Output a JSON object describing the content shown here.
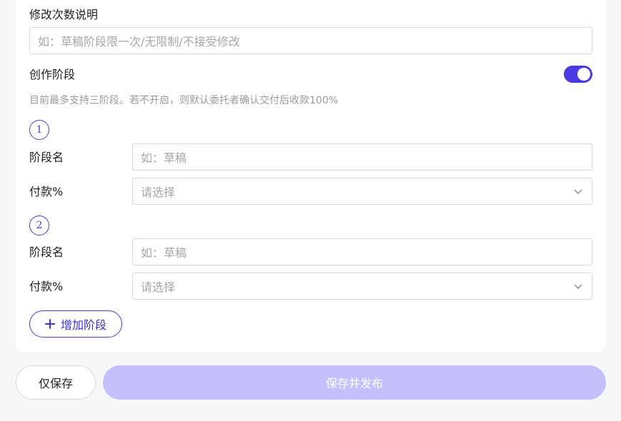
{
  "form": {
    "revision_label": "修改次数说明",
    "revision_placeholder": "如：草稿阶段限一次/无限制/不接受修改",
    "stages_label": "创作阶段",
    "stages_enabled": true,
    "stages_hint": "目前最多支持三阶段。若不开启，则默认委托者确认交付后收款100%",
    "stages": [
      {
        "number": "1",
        "name_label": "阶段名",
        "name_placeholder": "如：草稿",
        "payment_label": "付款%",
        "payment_placeholder": "请选择"
      },
      {
        "number": "2",
        "name_label": "阶段名",
        "name_placeholder": "如：草稿",
        "payment_label": "付款%",
        "payment_placeholder": "请选择"
      }
    ],
    "add_stage_label": "增加阶段"
  },
  "footer": {
    "save_only_label": "仅保存",
    "save_publish_label": "保存并发布"
  },
  "colors": {
    "accent": "#4a3ce0",
    "publish_disabled": "#c4c0fb",
    "background": "#f6f6f6"
  },
  "icons": {
    "add": "plus-icon",
    "dropdown": "chevron-down-icon"
  }
}
